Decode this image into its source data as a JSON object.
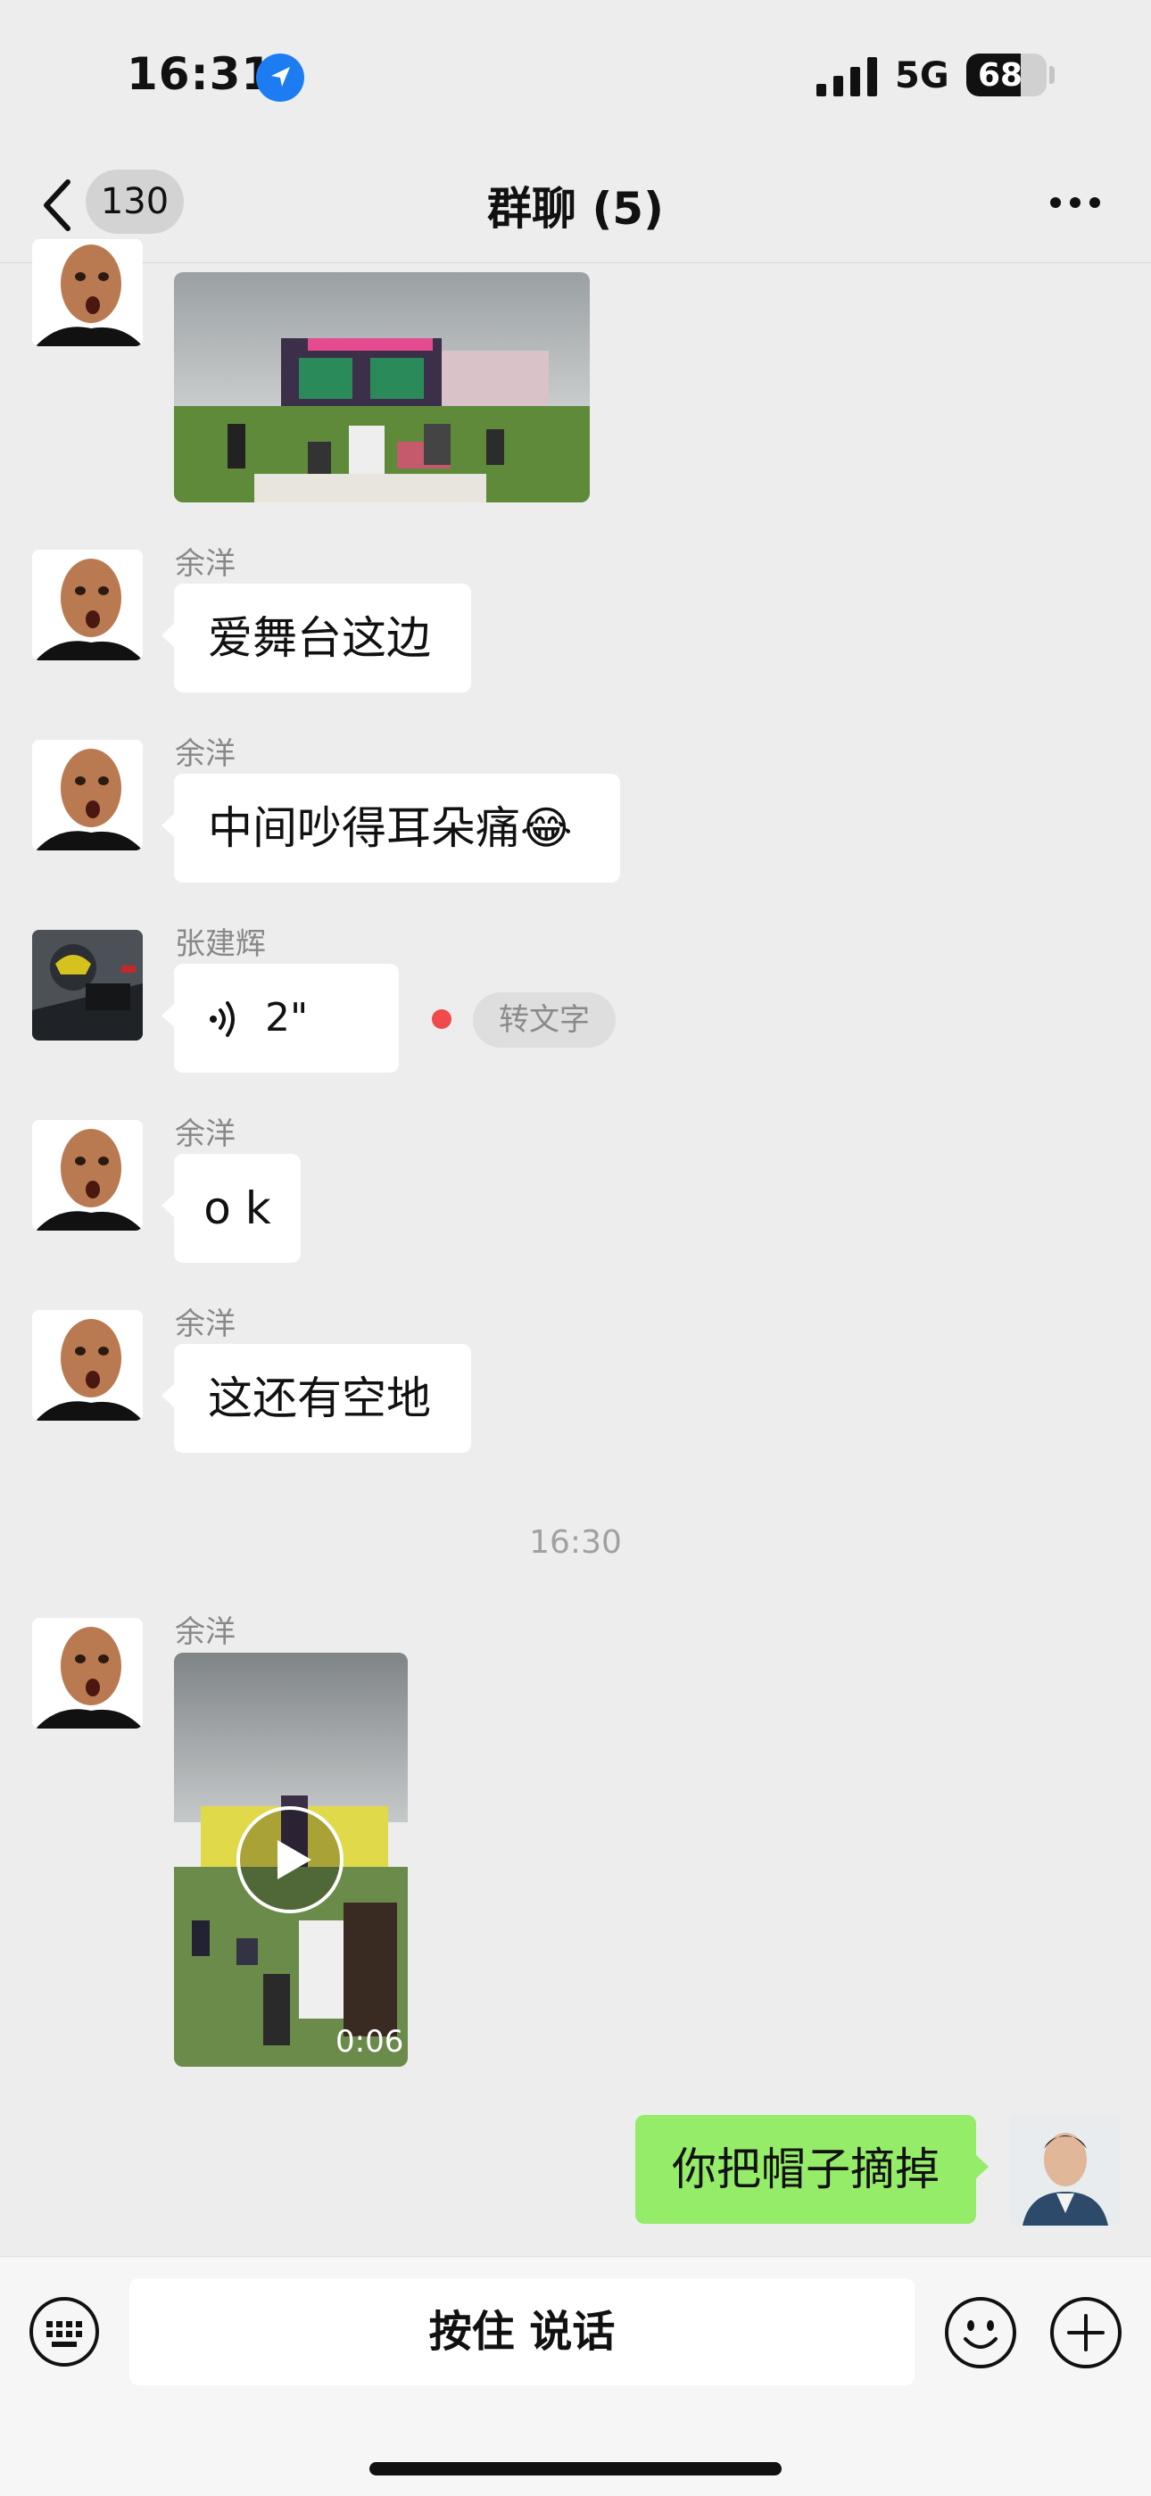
{
  "status": {
    "time": "16:31",
    "network": "5G",
    "battery": "68",
    "battery_level": 0.68
  },
  "nav": {
    "back_count": "130",
    "title": "群聊 (5)"
  },
  "messages": [
    {
      "sender": "",
      "type": "image",
      "avatar": "bald-man-avatar"
    },
    {
      "sender": "余洋",
      "type": "text",
      "text": "爱舞台这边",
      "avatar": "bald-man-avatar"
    },
    {
      "sender": "余洋",
      "type": "text",
      "text": "中间吵得耳朵痛😂",
      "avatar": "bald-man-avatar"
    },
    {
      "sender": "张建辉",
      "type": "voice",
      "duration": "2\"",
      "action": "转文字",
      "avatar": "motorcycle-helmet-avatar"
    },
    {
      "sender": "余洋",
      "type": "text",
      "text": "o k",
      "avatar": "bald-man-avatar"
    },
    {
      "sender": "余洋",
      "type": "text",
      "text": "这还有空地",
      "avatar": "bald-man-avatar"
    },
    {
      "sender": "余洋",
      "type": "video",
      "duration": "0:06",
      "avatar": "bald-man-avatar"
    },
    {
      "sender": "self",
      "type": "text",
      "text": "你把帽子摘掉",
      "avatar": "self-avatar"
    }
  ],
  "timestamp": "16:30",
  "input": {
    "talk_label": "按住 说话"
  },
  "colors": {
    "background": "#ededed",
    "self_bubble": "#95ec69",
    "unread_dot": "#f04a4a",
    "location_icon": "#1d7cf2"
  },
  "icons": [
    "location-arrow-icon",
    "signal-icon",
    "back-chevron-icon",
    "more-dots-icon",
    "voice-wave-icon",
    "play-icon",
    "keyboard-icon",
    "emoji-icon",
    "plus-icon"
  ]
}
